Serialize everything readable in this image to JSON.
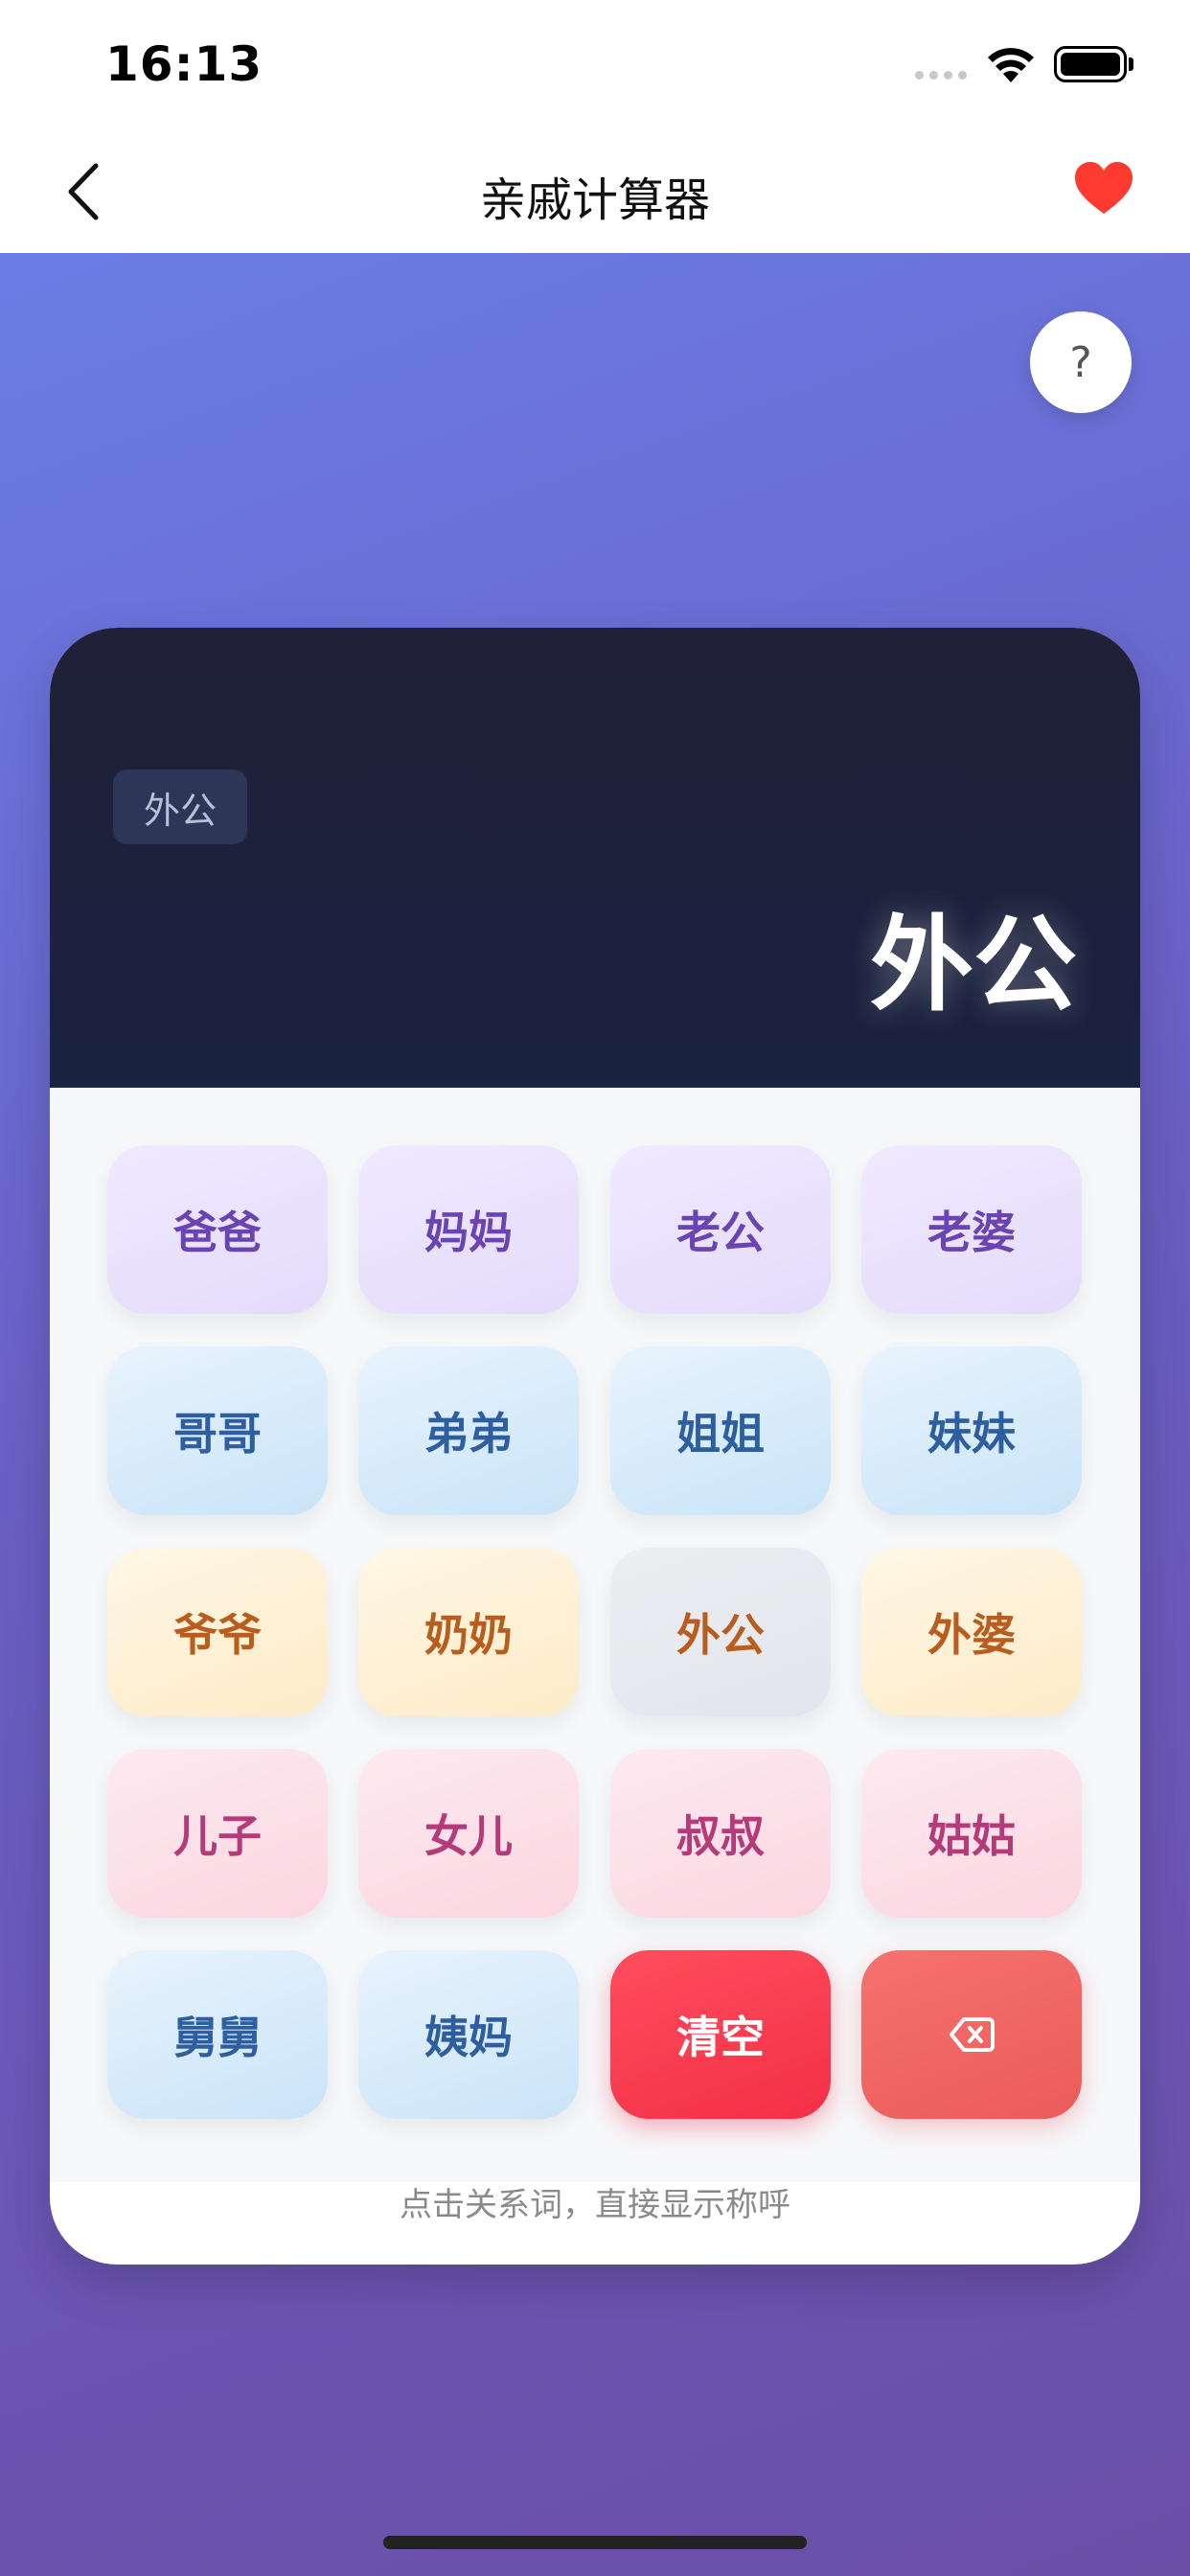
{
  "status": {
    "time": "16:13"
  },
  "nav": {
    "title": "亲戚计算器"
  },
  "help": {
    "label": "?"
  },
  "display": {
    "input_chip": "外公",
    "result": "外公"
  },
  "keys": [
    [
      "爸爸",
      "妈妈",
      "老公",
      "老婆"
    ],
    [
      "哥哥",
      "弟弟",
      "姐姐",
      "妹妹"
    ],
    [
      "爷爷",
      "奶奶",
      "外公",
      "外婆"
    ],
    [
      "儿子",
      "女儿",
      "叔叔",
      "姑姑"
    ],
    [
      "舅舅",
      "姨妈",
      "清空",
      ""
    ]
  ],
  "hint": "点击关系词，直接显示称呼",
  "colors": {
    "accent_red": "#f23046",
    "heart": "#ff3b30"
  }
}
